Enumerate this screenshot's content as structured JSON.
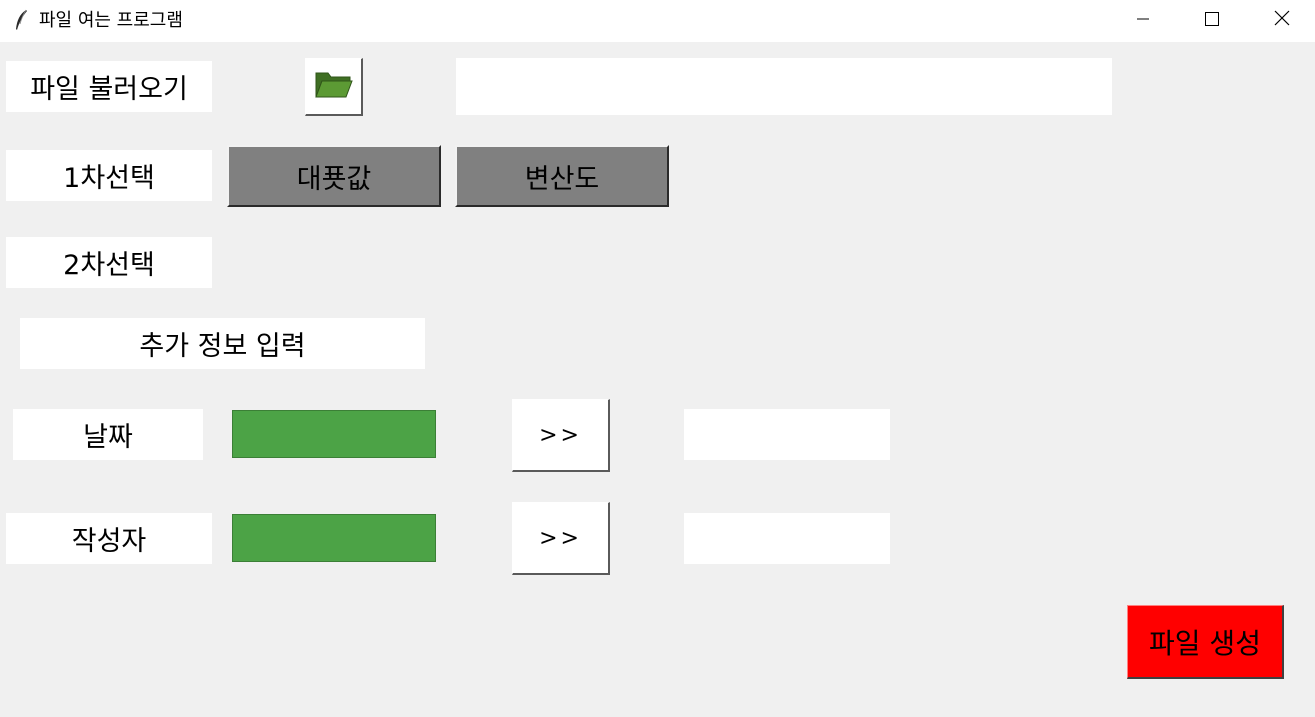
{
  "window": {
    "title": "파일 여는 프로그램",
    "app_icon": "feather-icon",
    "controls": [
      "minimize-icon",
      "maximize-icon",
      "close-icon"
    ]
  },
  "file_row": {
    "label": "파일 불러오기",
    "open_icon": "folder-open-icon",
    "path_value": ""
  },
  "first_select": {
    "label": "1차선택",
    "options": [
      "대푯값",
      "변산도"
    ]
  },
  "second_select": {
    "label": "2차선택"
  },
  "extra_info": {
    "label": "추가 정보 입력"
  },
  "date_row": {
    "label": "날짜",
    "arrow_label": ">>",
    "value": ""
  },
  "author_row": {
    "label": "작성자",
    "arrow_label": ">>",
    "value": ""
  },
  "actions": {
    "create_label": "파일 생성"
  },
  "colors": {
    "background": "#f0f0f0",
    "option_button": "#808080",
    "green_field": "#4ca346",
    "create_button": "#ff0000",
    "folder_icon": "#4e8a2e"
  }
}
